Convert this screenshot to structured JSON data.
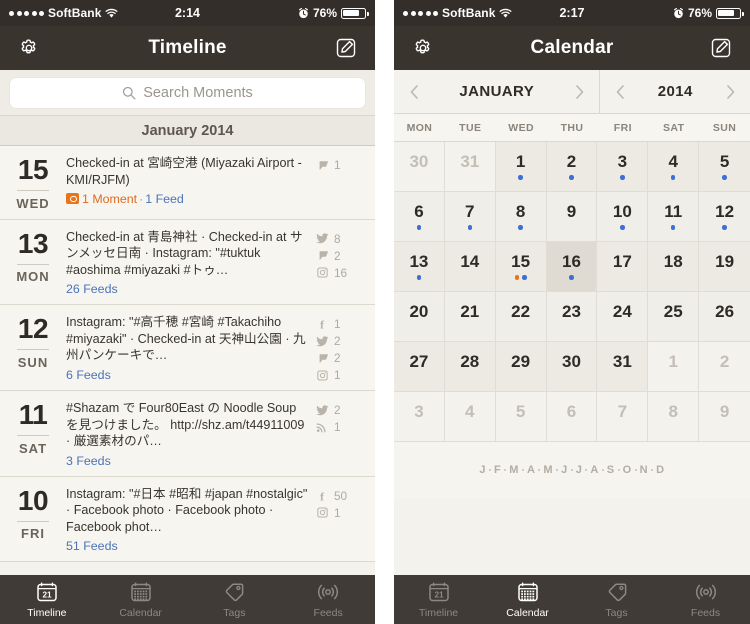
{
  "phones": [
    {
      "id": "timeline-screen",
      "status_bar": {
        "signal_dots": 5,
        "carrier": "SoftBank",
        "wifi_icon": "wifi-icon",
        "time": "2:14",
        "alarm_icon": "alarm-clock-icon",
        "battery_percent": "76%",
        "battery_level": 76
      },
      "nav_bar": {
        "left_icon": "gear-icon",
        "title": "Timeline",
        "right_icon": "compose-icon"
      },
      "search": {
        "icon": "search-icon",
        "placeholder": "Search Moments"
      },
      "section_header": "January 2014",
      "entries": [
        {
          "day": "15",
          "dow": "WED",
          "text": "Checked-in at 宮崎空港 (Miyazaki Airport - KMI/RJFM)",
          "moment_label": "1 Moment",
          "separator": "·",
          "feed_label": "1 Feed",
          "counts": [
            {
              "icon": "foursquare-icon",
              "value": "1"
            }
          ]
        },
        {
          "day": "13",
          "dow": "MON",
          "text": "Checked-in at 青島神社 · Checked-in at サンメッセ日南 · Instagram: \"#tuktuk #aoshima #miyazaki #トゥ…",
          "feeds_label": "26 Feeds",
          "counts": [
            {
              "icon": "twitter-icon",
              "value": "8"
            },
            {
              "icon": "foursquare-icon",
              "value": "2"
            },
            {
              "icon": "instagram-icon",
              "value": "16"
            }
          ]
        },
        {
          "day": "12",
          "dow": "SUN",
          "text": "Instagram: \"#高千穂 #宮崎 #Takachiho #miyazaki\" · Checked-in at 天神山公園 · 九州パンケーキで…",
          "feeds_label": "6 Feeds",
          "counts": [
            {
              "icon": "facebook-icon",
              "value": "1"
            },
            {
              "icon": "twitter-icon",
              "value": "2"
            },
            {
              "icon": "foursquare-icon",
              "value": "2"
            },
            {
              "icon": "instagram-icon",
              "value": "1"
            }
          ]
        },
        {
          "day": "11",
          "dow": "SAT",
          "text": "#Shazam で Four80East の Noodle Soup を見つけました。 http://shz.am/t44911009 · 厳選素材のパ…",
          "feeds_label": "3 Feeds",
          "counts": [
            {
              "icon": "twitter-icon",
              "value": "2"
            },
            {
              "icon": "rss-icon",
              "value": "1"
            }
          ]
        },
        {
          "day": "10",
          "dow": "FRI",
          "text": "Instagram: \"#日本 #昭和 #japan #nostalgic\" · Facebook photo · Facebook photo · Facebook phot…",
          "feeds_label": "51 Feeds",
          "counts": [
            {
              "icon": "facebook-icon",
              "value": "50"
            },
            {
              "icon": "instagram-icon",
              "value": "1"
            }
          ]
        }
      ],
      "tabs": [
        {
          "label": "Timeline",
          "icon": "calendar-day-icon",
          "active": true
        },
        {
          "label": "Calendar",
          "icon": "calendar-grid-icon",
          "active": false
        },
        {
          "label": "Tags",
          "icon": "tag-icon",
          "active": false
        },
        {
          "label": "Feeds",
          "icon": "broadcast-icon",
          "active": false
        }
      ]
    },
    {
      "id": "calendar-screen",
      "status_bar": {
        "signal_dots": 5,
        "carrier": "SoftBank",
        "wifi_icon": "wifi-icon",
        "time": "2:17",
        "alarm_icon": "alarm-clock-icon",
        "battery_percent": "76%",
        "battery_level": 76
      },
      "nav_bar": {
        "left_icon": "gear-icon",
        "title": "Calendar",
        "right_icon": "compose-icon"
      },
      "cal_nav": {
        "month_prev_icon": "chevron-left-icon",
        "month": "JANUARY",
        "month_next_icon": "chevron-right-icon",
        "year_prev_icon": "chevron-left-icon",
        "year": "2014",
        "year_next_icon": "chevron-right-icon"
      },
      "weekdays": [
        "MON",
        "TUE",
        "WED",
        "THU",
        "FRI",
        "SAT",
        "SUN"
      ],
      "days": [
        {
          "n": "30",
          "muted": true,
          "dots": []
        },
        {
          "n": "31",
          "muted": true,
          "dots": []
        },
        {
          "n": "1",
          "muted": false,
          "dots": [
            "blue"
          ]
        },
        {
          "n": "2",
          "muted": false,
          "dots": [
            "blue"
          ]
        },
        {
          "n": "3",
          "muted": false,
          "dots": [
            "blue"
          ]
        },
        {
          "n": "4",
          "muted": false,
          "dots": [
            "blue"
          ]
        },
        {
          "n": "5",
          "muted": false,
          "dots": [
            "blue"
          ]
        },
        {
          "n": "6",
          "muted": false,
          "dots": [
            "blue"
          ]
        },
        {
          "n": "7",
          "muted": false,
          "dots": [
            "blue"
          ]
        },
        {
          "n": "8",
          "muted": false,
          "dots": [
            "blue"
          ]
        },
        {
          "n": "9",
          "muted": false,
          "dots": []
        },
        {
          "n": "10",
          "muted": false,
          "dots": [
            "blue"
          ]
        },
        {
          "n": "11",
          "muted": false,
          "dots": [
            "blue"
          ]
        },
        {
          "n": "12",
          "muted": false,
          "dots": [
            "blue"
          ]
        },
        {
          "n": "13",
          "muted": false,
          "dots": [
            "blue"
          ]
        },
        {
          "n": "14",
          "muted": false,
          "dots": []
        },
        {
          "n": "15",
          "muted": false,
          "dots": [
            "orange",
            "blue"
          ]
        },
        {
          "n": "16",
          "muted": false,
          "dots": [
            "blue"
          ],
          "selected": true
        },
        {
          "n": "17",
          "muted": false,
          "dots": []
        },
        {
          "n": "18",
          "muted": false,
          "dots": []
        },
        {
          "n": "19",
          "muted": false,
          "dots": []
        },
        {
          "n": "20",
          "muted": false,
          "dots": []
        },
        {
          "n": "21",
          "muted": false,
          "dots": []
        },
        {
          "n": "22",
          "muted": false,
          "dots": []
        },
        {
          "n": "23",
          "muted": false,
          "dots": []
        },
        {
          "n": "24",
          "muted": false,
          "dots": []
        },
        {
          "n": "25",
          "muted": false,
          "dots": []
        },
        {
          "n": "26",
          "muted": false,
          "dots": []
        },
        {
          "n": "27",
          "muted": false,
          "dots": []
        },
        {
          "n": "28",
          "muted": false,
          "dots": []
        },
        {
          "n": "29",
          "muted": false,
          "dots": []
        },
        {
          "n": "30",
          "muted": false,
          "dots": []
        },
        {
          "n": "31",
          "muted": false,
          "dots": []
        },
        {
          "n": "1",
          "muted": true,
          "dots": []
        },
        {
          "n": "2",
          "muted": true,
          "dots": []
        },
        {
          "n": "3",
          "muted": true,
          "dots": []
        },
        {
          "n": "4",
          "muted": true,
          "dots": []
        },
        {
          "n": "5",
          "muted": true,
          "dots": []
        },
        {
          "n": "6",
          "muted": true,
          "dots": []
        },
        {
          "n": "7",
          "muted": true,
          "dots": []
        },
        {
          "n": "8",
          "muted": true,
          "dots": []
        },
        {
          "n": "9",
          "muted": true,
          "dots": []
        }
      ],
      "month_strip": [
        "J",
        "F",
        "M",
        "A",
        "M",
        "J",
        "J",
        "A",
        "S",
        "O",
        "N",
        "D"
      ],
      "tabs": [
        {
          "label": "Timeline",
          "icon": "calendar-day-icon",
          "active": false
        },
        {
          "label": "Calendar",
          "icon": "calendar-grid-icon",
          "active": true
        },
        {
          "label": "Tags",
          "icon": "tag-icon",
          "active": false
        },
        {
          "label": "Feeds",
          "icon": "broadcast-icon",
          "active": false
        }
      ]
    }
  ],
  "colors": {
    "nav_bg": "#3a342f",
    "status_bg": "#332e2a",
    "page_bg": "#f7f5f0",
    "accent_blue": "#4b73b8",
    "accent_orange": "#e8751a",
    "dot_blue": "#3d6fd4",
    "tabbar_bg": "#342f2a"
  }
}
